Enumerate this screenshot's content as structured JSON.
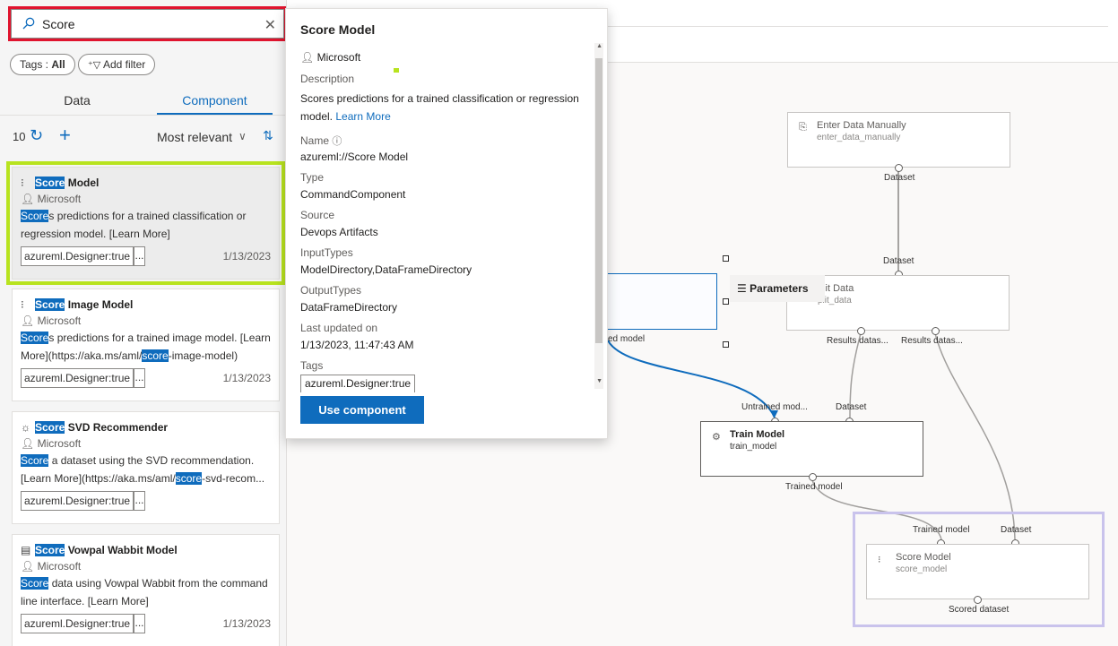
{
  "search": {
    "value": "Score",
    "clear_icon": "close-icon"
  },
  "filters": {
    "tags_label": "Tags : ",
    "tags_value": "All",
    "add_filter": "Add filter"
  },
  "tabs": [
    {
      "label": "Data"
    },
    {
      "label": "Component"
    }
  ],
  "results": {
    "count": "10",
    "sort": "Most relevant"
  },
  "cards": [
    {
      "hl": "Score",
      "title_rest": " Model",
      "publisher": "Microsoft",
      "desc1_hl": "Score",
      "desc1_rest": "s predictions for a trained classification or",
      "desc2": "regression model. [Learn More](https://aka.ms/aml/...",
      "tag": "azureml.Designer:true",
      "more": "...",
      "date": "1/13/2023"
    },
    {
      "hl": "Score",
      "title_rest": " Image Model",
      "publisher": "Microsoft",
      "desc1_hl": "Score",
      "desc1_rest": "s predictions for a trained image model. [Learn",
      "desc2_pre": "More](https://aka.ms/aml/",
      "desc2_hl": "score",
      "desc2_post": "-image-model)",
      "tag": "azureml.Designer:true",
      "more": "...",
      "date": "1/13/2023"
    },
    {
      "hl": "Score",
      "title_rest": " SVD Recommender",
      "publisher": "Microsoft",
      "desc1_hl": "Score",
      "desc1_rest": " a dataset using the SVD recommendation.",
      "desc2_pre": "[Learn More](https://aka.ms/aml/",
      "desc2_hl": "score",
      "desc2_post": "-svd-recom...",
      "tag": "azureml.Designer:true",
      "more": "...",
      "date": "1/13/2023"
    },
    {
      "hl": "Score",
      "title_rest": " Vowpal Wabbit Model",
      "publisher": "Microsoft",
      "desc1_hl": "Score",
      "desc1_rest": " data using Vowpal Wabbit from the command",
      "desc2": "line interface. [Learn More](https://aka.ms/aml/scor...",
      "tag": "azureml.Designer:true",
      "more": "...",
      "date": "1/13/2023"
    }
  ],
  "popover": {
    "title": "Score Model",
    "publisher": "Microsoft",
    "description_label": "Description",
    "description_1": "Scores predictions for a trained classification or regression",
    "description_2": "model.",
    "learn_more": "Learn More",
    "name_label": "Name",
    "name_value": "azureml://Score Model",
    "type_label": "Type",
    "type_value": "CommandComponent",
    "source_label": "Source",
    "source_value": "Devops Artifacts",
    "input_label": "InputTypes",
    "input_value": "ModelDirectory,DataFrameDirectory",
    "output_label": "OutputTypes",
    "output_value": "DataFrameDirectory",
    "updated_label": "Last updated on",
    "updated_value": "1/13/2023, 11:47:43 AM",
    "tags_label": "Tags",
    "tag_value": "azureml.Designer:true",
    "use_button": "Use component"
  },
  "canvas": {
    "parameters": "Parameters",
    "enter_data": {
      "title": "Enter Data Manually",
      "sub": "enter_data_manually",
      "out": "Dataset"
    },
    "split_data": {
      "title": "plit Data",
      "sub": "plit_data",
      "in": "Dataset",
      "out1": "Results datas...",
      "out2": "Results datas..."
    },
    "left_label": "ed model",
    "train_model": {
      "title": "Train Model",
      "sub": "train_model",
      "in1": "Untrained mod...",
      "in2": "Dataset",
      "out": "Trained model"
    },
    "score_model": {
      "title": "Score Model",
      "sub": "score_model",
      "in1": "Trained model",
      "in2": "Dataset",
      "out": "Scored dataset"
    }
  },
  "colors": {
    "accent": "#0f6cbd",
    "search_outline": "#e0142e",
    "selected_outline": "#b8e31f",
    "score_node_outline": "#c9c3ec"
  }
}
